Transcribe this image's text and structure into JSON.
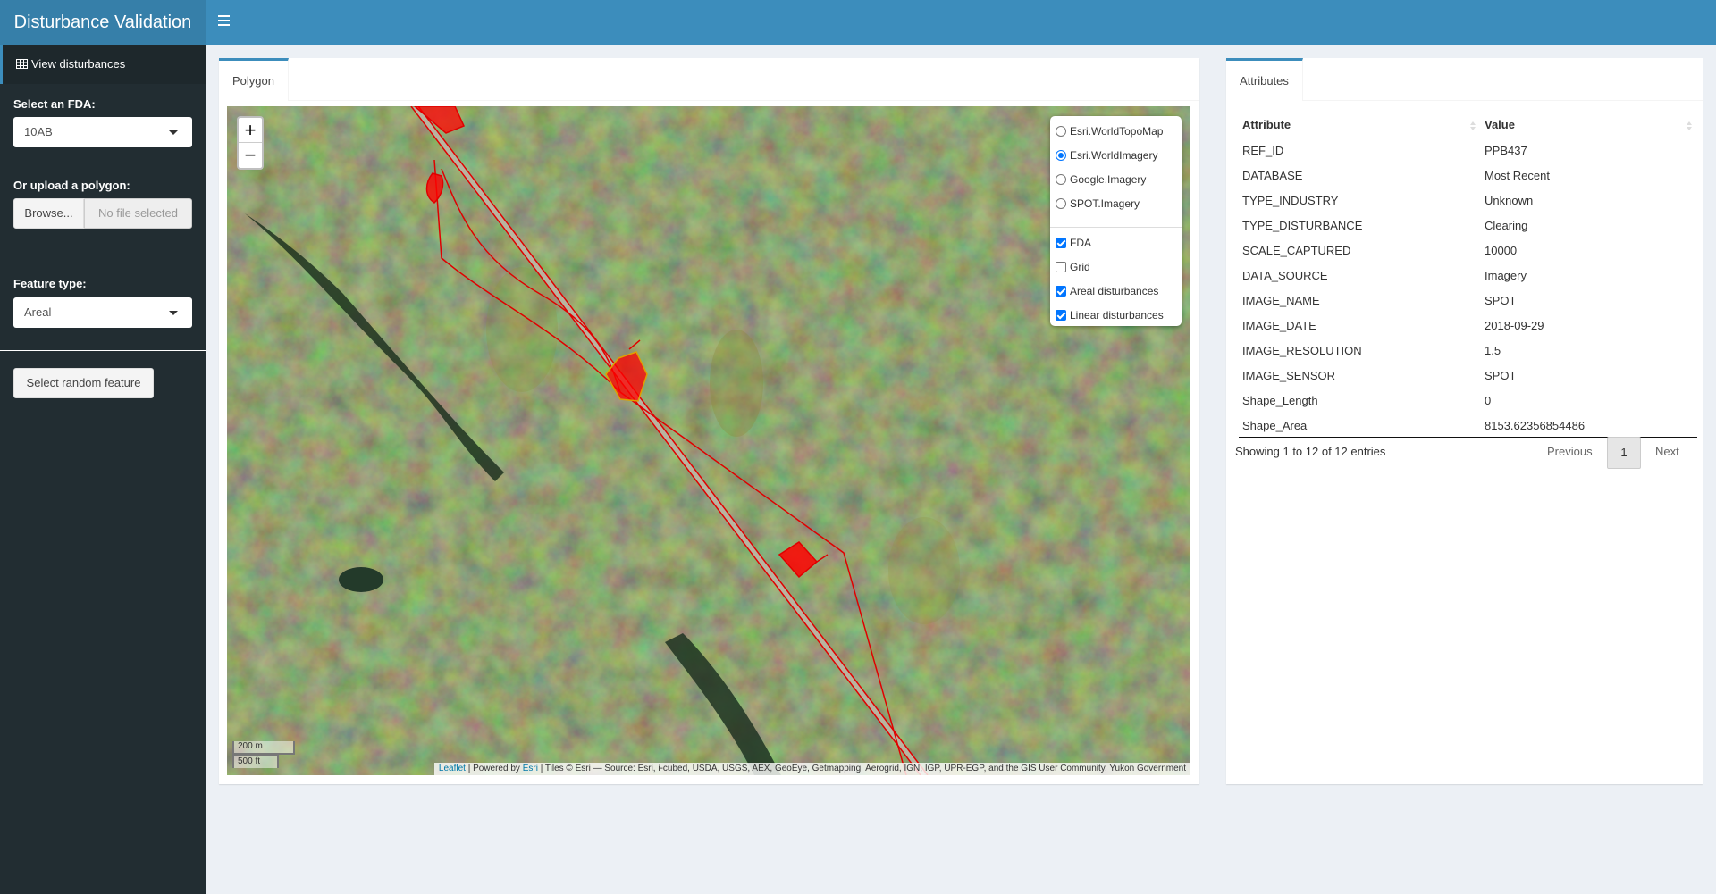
{
  "app": {
    "title": "Disturbance Validation"
  },
  "sidebar": {
    "menu_item": "View disturbances",
    "fda_label": "Select an FDA:",
    "fda_value": "10AB",
    "upload_label": "Or upload a polygon:",
    "browse_label": "Browse...",
    "file_placeholder": "No file selected",
    "feature_label": "Feature type:",
    "feature_value": "Areal",
    "random_button": "Select random feature"
  },
  "map_box": {
    "tab": "Polygon",
    "zoom_in": "+",
    "zoom_out": "−",
    "base_layers": [
      {
        "label": "Esri.WorldTopoMap",
        "selected": false
      },
      {
        "label": "Esri.WorldImagery",
        "selected": true
      },
      {
        "label": "Google.Imagery",
        "selected": false
      },
      {
        "label": "SPOT.Imagery",
        "selected": false
      }
    ],
    "overlays": [
      {
        "label": "FDA",
        "checked": true
      },
      {
        "label": "Grid",
        "checked": false
      },
      {
        "label": "Areal disturbances",
        "checked": true
      },
      {
        "label": "Linear disturbances",
        "checked": true
      }
    ],
    "scale_m": "200 m",
    "scale_ft": "500 ft",
    "attribution": {
      "leaflet": "Leaflet",
      "powered": " | Powered by ",
      "esri": "Esri",
      "tiles": " | Tiles © Esri — Source: Esri, i-cubed, USDA, USGS, AEX, GeoEye, Getmapping, Aerogrid, IGN, IGP, UPR-EGP, and the GIS User Community, Yukon Government"
    },
    "colors": {
      "disturbance": "#ff0000",
      "outline": "#e01010"
    }
  },
  "attributes_box": {
    "tab": "Attributes",
    "columns": [
      "Attribute",
      "Value"
    ],
    "rows": [
      [
        "REF_ID",
        "PPB437"
      ],
      [
        "DATABASE",
        "Most Recent"
      ],
      [
        "TYPE_INDUSTRY",
        "Unknown"
      ],
      [
        "TYPE_DISTURBANCE",
        "Clearing"
      ],
      [
        "SCALE_CAPTURED",
        "10000"
      ],
      [
        "DATA_SOURCE",
        "Imagery"
      ],
      [
        "IMAGE_NAME",
        "SPOT"
      ],
      [
        "IMAGE_DATE",
        "2018-09-29"
      ],
      [
        "IMAGE_RESOLUTION",
        "1.5"
      ],
      [
        "IMAGE_SENSOR",
        "SPOT"
      ],
      [
        "Shape_Length",
        "0"
      ],
      [
        "Shape_Area",
        "8153.62356854486"
      ]
    ],
    "info": "Showing 1 to 12 of 12 entries",
    "previous": "Previous",
    "page": "1",
    "next": "Next"
  }
}
